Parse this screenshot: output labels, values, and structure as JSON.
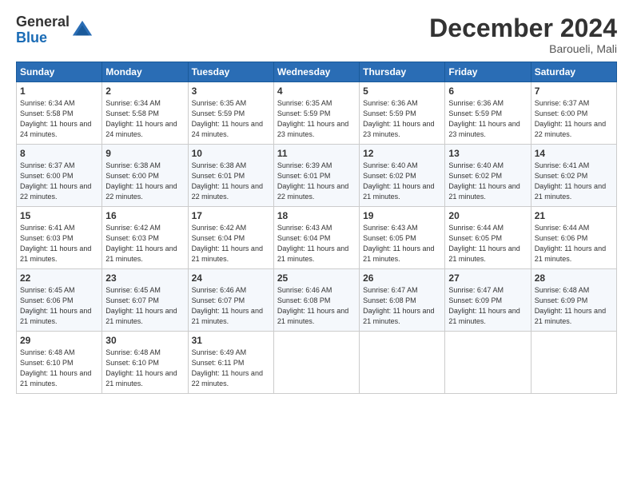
{
  "header": {
    "logo": {
      "general": "General",
      "blue": "Blue"
    },
    "title": "December 2024",
    "location": "Baroueli, Mali"
  },
  "calendar": {
    "weekdays": [
      "Sunday",
      "Monday",
      "Tuesday",
      "Wednesday",
      "Thursday",
      "Friday",
      "Saturday"
    ],
    "weeks": [
      [
        null,
        null,
        null,
        null,
        null,
        null,
        null
      ]
    ],
    "days": [
      {
        "date": 1,
        "col": 0,
        "sunrise": "6:34 AM",
        "sunset": "5:58 PM",
        "daylight": "11 hours and 24 minutes."
      },
      {
        "date": 2,
        "col": 1,
        "sunrise": "6:34 AM",
        "sunset": "5:58 PM",
        "daylight": "11 hours and 24 minutes."
      },
      {
        "date": 3,
        "col": 2,
        "sunrise": "6:35 AM",
        "sunset": "5:59 PM",
        "daylight": "11 hours and 24 minutes."
      },
      {
        "date": 4,
        "col": 3,
        "sunrise": "6:35 AM",
        "sunset": "5:59 PM",
        "daylight": "11 hours and 23 minutes."
      },
      {
        "date": 5,
        "col": 4,
        "sunrise": "6:36 AM",
        "sunset": "5:59 PM",
        "daylight": "11 hours and 23 minutes."
      },
      {
        "date": 6,
        "col": 5,
        "sunrise": "6:36 AM",
        "sunset": "5:59 PM",
        "daylight": "11 hours and 23 minutes."
      },
      {
        "date": 7,
        "col": 6,
        "sunrise": "6:37 AM",
        "sunset": "6:00 PM",
        "daylight": "11 hours and 22 minutes."
      },
      {
        "date": 8,
        "col": 0,
        "sunrise": "6:37 AM",
        "sunset": "6:00 PM",
        "daylight": "11 hours and 22 minutes."
      },
      {
        "date": 9,
        "col": 1,
        "sunrise": "6:38 AM",
        "sunset": "6:00 PM",
        "daylight": "11 hours and 22 minutes."
      },
      {
        "date": 10,
        "col": 2,
        "sunrise": "6:38 AM",
        "sunset": "6:01 PM",
        "daylight": "11 hours and 22 minutes."
      },
      {
        "date": 11,
        "col": 3,
        "sunrise": "6:39 AM",
        "sunset": "6:01 PM",
        "daylight": "11 hours and 22 minutes."
      },
      {
        "date": 12,
        "col": 4,
        "sunrise": "6:40 AM",
        "sunset": "6:02 PM",
        "daylight": "11 hours and 21 minutes."
      },
      {
        "date": 13,
        "col": 5,
        "sunrise": "6:40 AM",
        "sunset": "6:02 PM",
        "daylight": "11 hours and 21 minutes."
      },
      {
        "date": 14,
        "col": 6,
        "sunrise": "6:41 AM",
        "sunset": "6:02 PM",
        "daylight": "11 hours and 21 minutes."
      },
      {
        "date": 15,
        "col": 0,
        "sunrise": "6:41 AM",
        "sunset": "6:03 PM",
        "daylight": "11 hours and 21 minutes."
      },
      {
        "date": 16,
        "col": 1,
        "sunrise": "6:42 AM",
        "sunset": "6:03 PM",
        "daylight": "11 hours and 21 minutes."
      },
      {
        "date": 17,
        "col": 2,
        "sunrise": "6:42 AM",
        "sunset": "6:04 PM",
        "daylight": "11 hours and 21 minutes."
      },
      {
        "date": 18,
        "col": 3,
        "sunrise": "6:43 AM",
        "sunset": "6:04 PM",
        "daylight": "11 hours and 21 minutes."
      },
      {
        "date": 19,
        "col": 4,
        "sunrise": "6:43 AM",
        "sunset": "6:05 PM",
        "daylight": "11 hours and 21 minutes."
      },
      {
        "date": 20,
        "col": 5,
        "sunrise": "6:44 AM",
        "sunset": "6:05 PM",
        "daylight": "11 hours and 21 minutes."
      },
      {
        "date": 21,
        "col": 6,
        "sunrise": "6:44 AM",
        "sunset": "6:06 PM",
        "daylight": "11 hours and 21 minutes."
      },
      {
        "date": 22,
        "col": 0,
        "sunrise": "6:45 AM",
        "sunset": "6:06 PM",
        "daylight": "11 hours and 21 minutes."
      },
      {
        "date": 23,
        "col": 1,
        "sunrise": "6:45 AM",
        "sunset": "6:07 PM",
        "daylight": "11 hours and 21 minutes."
      },
      {
        "date": 24,
        "col": 2,
        "sunrise": "6:46 AM",
        "sunset": "6:07 PM",
        "daylight": "11 hours and 21 minutes."
      },
      {
        "date": 25,
        "col": 3,
        "sunrise": "6:46 AM",
        "sunset": "6:08 PM",
        "daylight": "11 hours and 21 minutes."
      },
      {
        "date": 26,
        "col": 4,
        "sunrise": "6:47 AM",
        "sunset": "6:08 PM",
        "daylight": "11 hours and 21 minutes."
      },
      {
        "date": 27,
        "col": 5,
        "sunrise": "6:47 AM",
        "sunset": "6:09 PM",
        "daylight": "11 hours and 21 minutes."
      },
      {
        "date": 28,
        "col": 6,
        "sunrise": "6:48 AM",
        "sunset": "6:09 PM",
        "daylight": "11 hours and 21 minutes."
      },
      {
        "date": 29,
        "col": 0,
        "sunrise": "6:48 AM",
        "sunset": "6:10 PM",
        "daylight": "11 hours and 21 minutes."
      },
      {
        "date": 30,
        "col": 1,
        "sunrise": "6:48 AM",
        "sunset": "6:10 PM",
        "daylight": "11 hours and 21 minutes."
      },
      {
        "date": 31,
        "col": 2,
        "sunrise": "6:49 AM",
        "sunset": "6:11 PM",
        "daylight": "11 hours and 22 minutes."
      }
    ]
  }
}
